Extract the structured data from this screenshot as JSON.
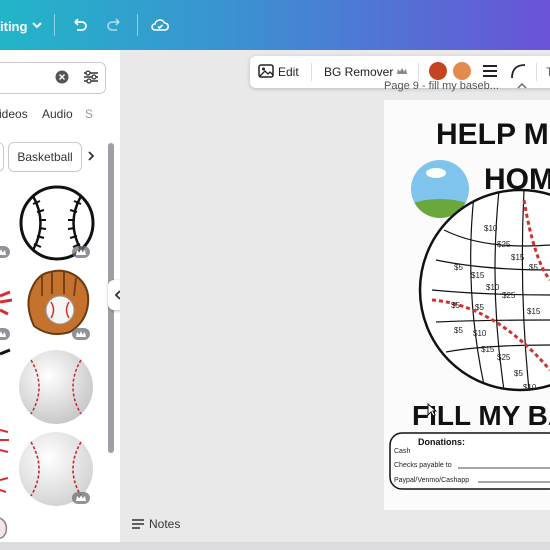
{
  "topbar": {
    "mode_label": "iting",
    "icons": [
      "chevron-down-icon",
      "undo-icon",
      "redo-icon",
      "cloud-sync-icon"
    ]
  },
  "sidepanel": {
    "search_value": "",
    "tabs": [
      {
        "label": "ideos"
      },
      {
        "label": "Audio"
      },
      {
        "label": "S"
      }
    ],
    "chips": [
      {
        "label": ""
      },
      {
        "label": "Basketball"
      }
    ],
    "thumbnails": [
      "baseball-lineart",
      "baseball-stitch-partial",
      "baseball-glove",
      "baseball-bat-partial",
      "baseball-ball-realistic",
      "baseball-partial-red",
      "baseball-ball-white",
      "baseball-hand-partial"
    ]
  },
  "context_toolbar": {
    "edit_label": "Edit",
    "bg_remover_label": "BG Remover",
    "swatch_colors": [
      "#c4441f",
      "#e58a4e"
    ]
  },
  "page": {
    "title": "Page 9 - fill my baseb...",
    "headline_1": "HELP M",
    "headline_2": "HOM",
    "footer_title": "FILL MY BA",
    "donations_label": "Donations:",
    "donation_lines": [
      "Cash",
      "Checks payable to",
      "Paypal/Venmo/Cashapp"
    ],
    "amounts": [
      "$10",
      "$25",
      "$5",
      "$15",
      "$5",
      "$10",
      "$15",
      "$25",
      "$5",
      "$5",
      "$10",
      "$15",
      "$15",
      "$25",
      "$5",
      "$10",
      "$5"
    ]
  },
  "notes": {
    "label": "Notes"
  },
  "colors": {
    "topbar_start": "#22b5c8",
    "topbar_end": "#6a53d7",
    "stitch_red": "#d32f2f"
  }
}
